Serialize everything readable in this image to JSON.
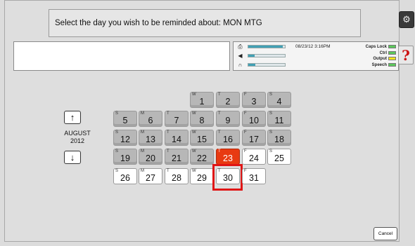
{
  "prompt": {
    "text": "Select the day you wish to be reminded about: MON MTG"
  },
  "status": {
    "timestamp": "08/23/12 3:16PM",
    "meters": [
      {
        "icon": "printer-icon",
        "glyph": "⎙",
        "level": 0.95
      },
      {
        "icon": "speaker-icon",
        "glyph": "◀",
        "level": 0.18
      },
      {
        "icon": "headphones-icon",
        "glyph": "∩",
        "level": 0.2
      }
    ],
    "indicators": [
      {
        "label": "Caps Lock",
        "color": "#5cc85c"
      },
      {
        "label": "Ctrl",
        "color": "#5cc85c"
      },
      {
        "label": "Output",
        "color": "#f2e21c"
      },
      {
        "label": "Speech",
        "color": "#5cc85c"
      }
    ]
  },
  "nav": {
    "month": "AUGUST",
    "year": "2012",
    "up_glyph": "↑",
    "down_glyph": "↓"
  },
  "calendar": {
    "days": [
      {
        "num": "1",
        "wd": "W",
        "state": "past"
      },
      {
        "num": "2",
        "wd": "T",
        "state": "past"
      },
      {
        "num": "3",
        "wd": "F",
        "state": "past"
      },
      {
        "num": "4",
        "wd": "S",
        "state": "past"
      },
      {
        "num": "5",
        "wd": "S",
        "state": "past"
      },
      {
        "num": "6",
        "wd": "M",
        "state": "past"
      },
      {
        "num": "7",
        "wd": "T",
        "state": "past"
      },
      {
        "num": "8",
        "wd": "W",
        "state": "past"
      },
      {
        "num": "9",
        "wd": "T",
        "state": "past"
      },
      {
        "num": "10",
        "wd": "F",
        "state": "past"
      },
      {
        "num": "11",
        "wd": "S",
        "state": "past"
      },
      {
        "num": "12",
        "wd": "S",
        "state": "past"
      },
      {
        "num": "13",
        "wd": "M",
        "state": "past"
      },
      {
        "num": "14",
        "wd": "T",
        "state": "past"
      },
      {
        "num": "15",
        "wd": "W",
        "state": "past"
      },
      {
        "num": "16",
        "wd": "T",
        "state": "past"
      },
      {
        "num": "17",
        "wd": "F",
        "state": "past"
      },
      {
        "num": "18",
        "wd": "S",
        "state": "past"
      },
      {
        "num": "19",
        "wd": "S",
        "state": "past"
      },
      {
        "num": "20",
        "wd": "M",
        "state": "past"
      },
      {
        "num": "21",
        "wd": "T",
        "state": "past"
      },
      {
        "num": "22",
        "wd": "W",
        "state": "past"
      },
      {
        "num": "23",
        "wd": "T",
        "state": "today"
      },
      {
        "num": "24",
        "wd": "F",
        "state": "future"
      },
      {
        "num": "25",
        "wd": "S",
        "state": "future"
      },
      {
        "num": "26",
        "wd": "S",
        "state": "future"
      },
      {
        "num": "27",
        "wd": "M",
        "state": "future"
      },
      {
        "num": "28",
        "wd": "T",
        "state": "future"
      },
      {
        "num": "29",
        "wd": "W",
        "state": "future"
      },
      {
        "num": "30",
        "wd": "T",
        "state": "future",
        "selected": true
      },
      {
        "num": "31",
        "wd": "F",
        "state": "future"
      }
    ],
    "colors": {
      "today": "#e83a12",
      "selection": "#e01515"
    }
  },
  "top_right": {
    "settings_glyph": "⚙",
    "help_label": "?"
  },
  "cancel_label": "Cancel"
}
